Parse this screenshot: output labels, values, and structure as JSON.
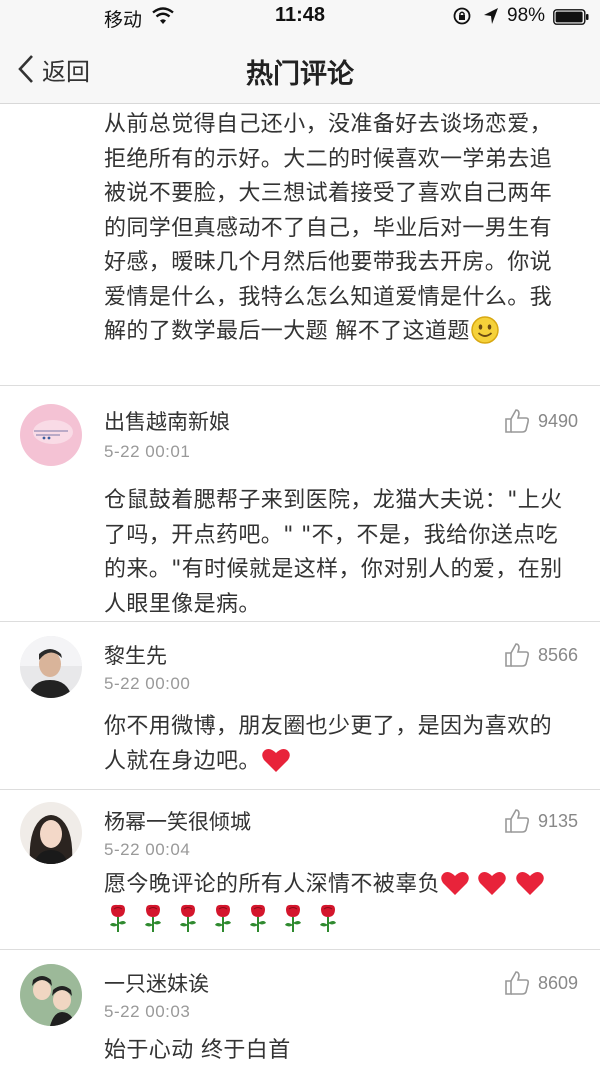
{
  "status": {
    "carrier": "移动",
    "time": "11:48",
    "battery": "98%"
  },
  "nav": {
    "back_label": "返回",
    "title": "热门评论"
  },
  "top_comment": {
    "text": "从前总觉得自己还小，没准备好去谈场恋爱，拒绝所有的示好。大二的时候喜欢一学弟去追被说不要脸，大三想试着接受了喜欢自己两年的同学但真感动不了自己，毕业后对一男生有好感，暧昧几个月然后他要带我去开房。你说爱情是什么，我特么怎么知道爱情是什么。我解的了数学最后一大题 解不了这道题"
  },
  "comments": [
    {
      "username": "出售越南新娘",
      "time": "5-22 00:01",
      "likes": "9490",
      "text": "仓鼠鼓着腮帮子来到医院，龙猫大夫说：\"上火了吗，开点药吧。\" \"不，不是，我给你送点吃的来。\"有时候就是这样，你对别人的爱，在别人眼里像是病。"
    },
    {
      "username": "黎生先",
      "time": "5-22 00:00",
      "likes": "8566",
      "text": "你不用微博，朋友圈也少更了，是因为喜欢的人就在身边吧。"
    },
    {
      "username": "杨幂一笑很倾城",
      "time": "5-22 00:04",
      "likes": "9135",
      "text": "愿今晚评论的所有人深情不被辜负"
    },
    {
      "username": "一只迷妹诶",
      "time": "5-22 00:03",
      "likes": "8609",
      "text": "始于心动 终于白首"
    }
  ],
  "colors": {
    "background": "#f2f2f2",
    "card": "#ffffff",
    "text": "#333333",
    "meta": "#999999",
    "heart": "#e8233a",
    "rose": "#d4162c"
  },
  "icons": {
    "back": "chevron-left-icon",
    "like": "thumbs-up-icon",
    "wifi": "wifi-icon",
    "lock": "rotation-lock-icon",
    "location": "location-arrow-icon",
    "battery": "battery-icon"
  }
}
